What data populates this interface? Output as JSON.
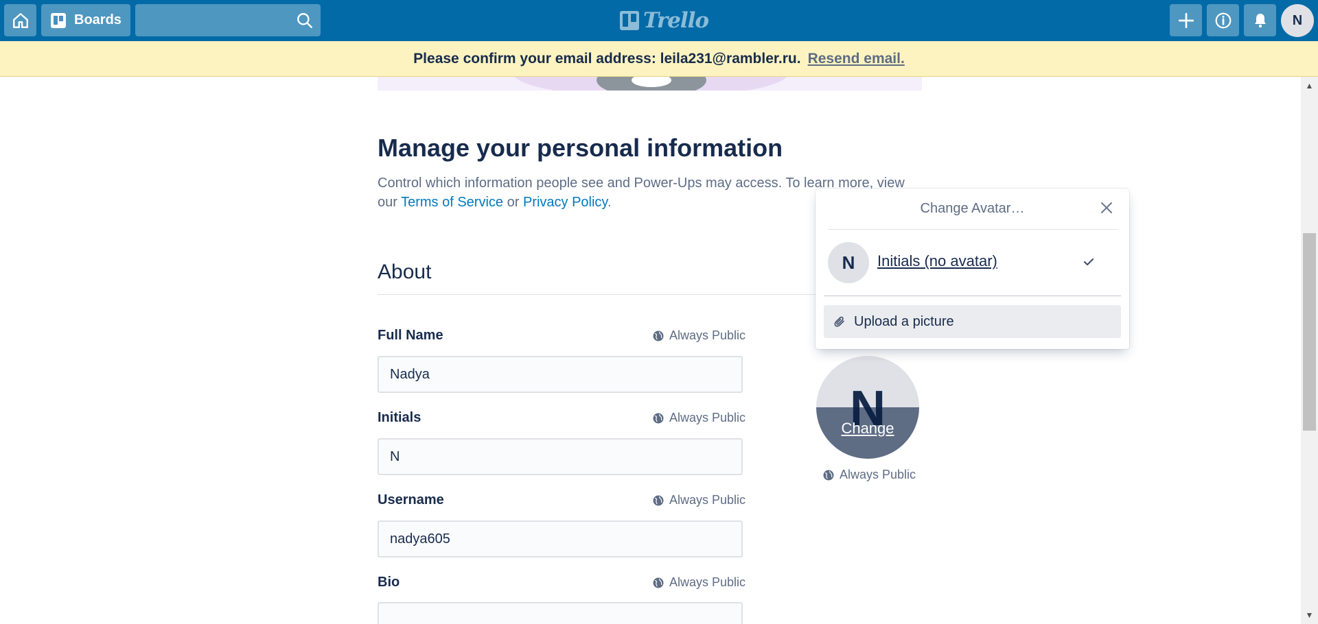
{
  "header": {
    "boards_label": "Boards",
    "search_placeholder": "",
    "logo_text": "Trello",
    "avatar_initial": "N"
  },
  "banner": {
    "message": "Please confirm your email address: leila231@rambler.ru.",
    "resend_label": "Resend email."
  },
  "page": {
    "title": "Manage your personal information",
    "desc_before": "Control which information people see and Power-Ups may access. To learn more, view our ",
    "terms_link": "Terms of Service",
    "desc_or": " or ",
    "privacy_link": "Privacy Policy",
    "desc_after": ".",
    "section_title": "About"
  },
  "fields": {
    "full_name": {
      "label": "Full Name",
      "visibility": "Always Public",
      "value": "Nadya"
    },
    "initials": {
      "label": "Initials",
      "visibility": "Always Public",
      "value": "N"
    },
    "username": {
      "label": "Username",
      "visibility": "Always Public",
      "value": "nadya605"
    },
    "bio": {
      "label": "Bio",
      "visibility": "Always Public",
      "value": ""
    }
  },
  "avatar": {
    "initial": "N",
    "change_label": "Change",
    "visibility": "Always Public"
  },
  "popover": {
    "title": "Change Avatar…",
    "option_initial": "N",
    "option_label": "Initials (no avatar)",
    "upload_label": "Upload a picture"
  },
  "colors": {
    "header_bg": "#026aa7",
    "banner_bg": "#fcf3c0",
    "link": "#0079bf",
    "text": "#172b4d"
  },
  "icons": [
    "home-icon",
    "boards-icon",
    "search-icon",
    "trello-logo-icon",
    "plus-icon",
    "info-icon",
    "bell-icon",
    "globe-icon",
    "close-icon",
    "check-icon",
    "paperclip-icon"
  ]
}
